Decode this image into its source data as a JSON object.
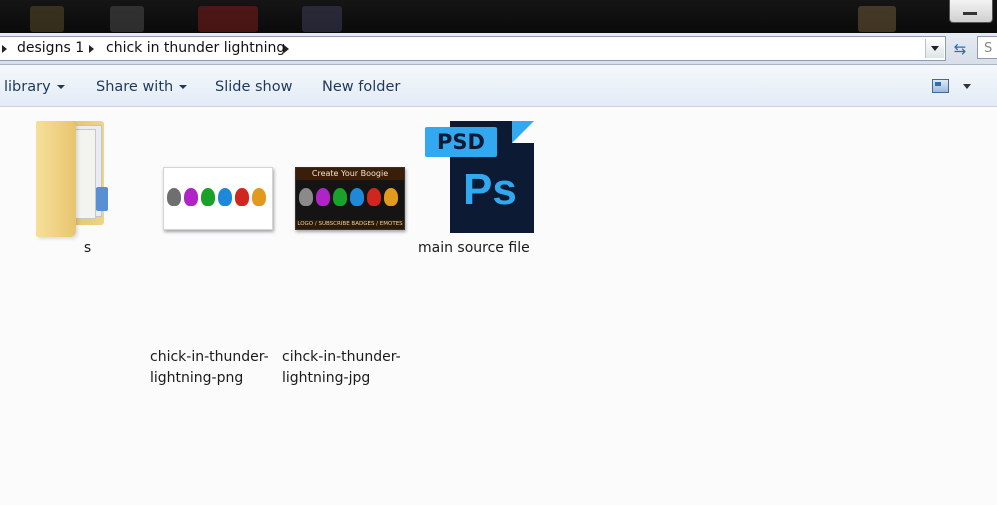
{
  "breadcrumb": {
    "items": [
      "designs 1",
      "chick in thunder lightning"
    ],
    "search_placeholder": "S"
  },
  "toolbar": {
    "library_label": "library",
    "share_label": "Share with",
    "slideshow_label": "Slide show",
    "newfolder_label": "New folder"
  },
  "files": [
    {
      "name": "s",
      "type": "folder"
    },
    {
      "name_line1": "chick-in-thunder-",
      "name_line2": "lightning-png",
      "type": "image"
    },
    {
      "name_line1": "cihck-in-thunder-",
      "name_line2": "lightning-jpg",
      "type": "image"
    },
    {
      "name": "main source file",
      "type": "psd"
    }
  ],
  "thumbnails": {
    "jpg_banner": "Create Your Boogie",
    "jpg_footer": "LOGO / SUBSCRIBE BADGES / EMOTES",
    "psd_tag": "PSD",
    "ps_logo": "Ps"
  },
  "colors": {
    "accent": "#31a8f0",
    "psd_dark": "#0c1a33",
    "toolbar_text": "#1e395b"
  },
  "icons": [
    "folder-icon",
    "image-thumbnail",
    "psd-file-icon",
    "refresh-icon",
    "view-options-icon"
  ]
}
